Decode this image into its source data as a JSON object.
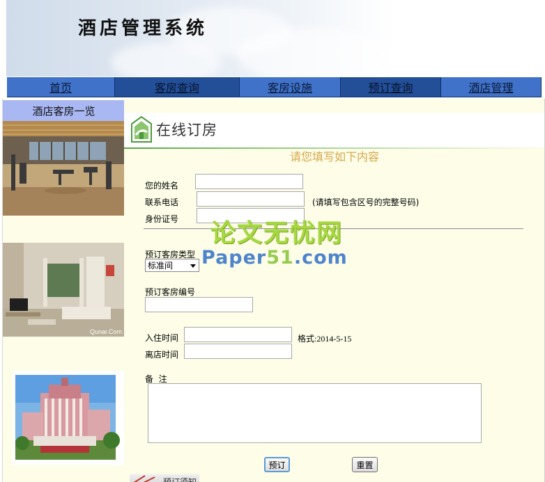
{
  "header": {
    "title": "酒店管理系统"
  },
  "nav": {
    "items": [
      {
        "label": "首页",
        "style": "light",
        "width": 155
      },
      {
        "label": "客房查询",
        "style": "dark",
        "width": 179
      },
      {
        "label": "客房设施",
        "style": "light",
        "width": 145
      },
      {
        "label": "预订查询",
        "style": "dark",
        "width": 144
      },
      {
        "label": "酒店管理",
        "style": "light",
        "width": 144
      }
    ]
  },
  "sidebar": {
    "title": "酒店客房一览",
    "photo_watermark": "Qunar.Com"
  },
  "main": {
    "section_title": "在线订房",
    "subtitle": "请您填写如下内容",
    "form": {
      "name_label": "您的姓名",
      "phone_label": "联系电话",
      "phone_hint": "(请填写包含区号的完整号码)",
      "id_label": "身份证号",
      "room_type_label": "预订客房类型",
      "room_type_selected": "标准间",
      "room_number_label": "预订客房编号",
      "checkin_label": "入住时间",
      "date_format_hint": "格式:2014-5-15",
      "checkout_label": "离店时间",
      "remarks_label": "备  注",
      "submit_label": "预订",
      "reset_label": "重置"
    },
    "notice_label": "预订须知"
  },
  "watermark": {
    "line1": "论文无忧网",
    "line2_a": "Paper",
    "line2_b": "51",
    "line2_c": ".com"
  },
  "colors": {
    "nav_light": "#3f72c8",
    "nav_dark": "#234f98",
    "sidebar_title_bg": "#a9b7f3",
    "content_bg": "#fdfde8",
    "subtitle": "#d6a84a",
    "watermark_green": "#9ed62f",
    "watermark_blue": "#3c78c8"
  },
  "icons": {
    "online_booking": "hotel-logo-icon",
    "select_arrow": "chevron-down-icon",
    "notice": "pencil-note-icon"
  }
}
